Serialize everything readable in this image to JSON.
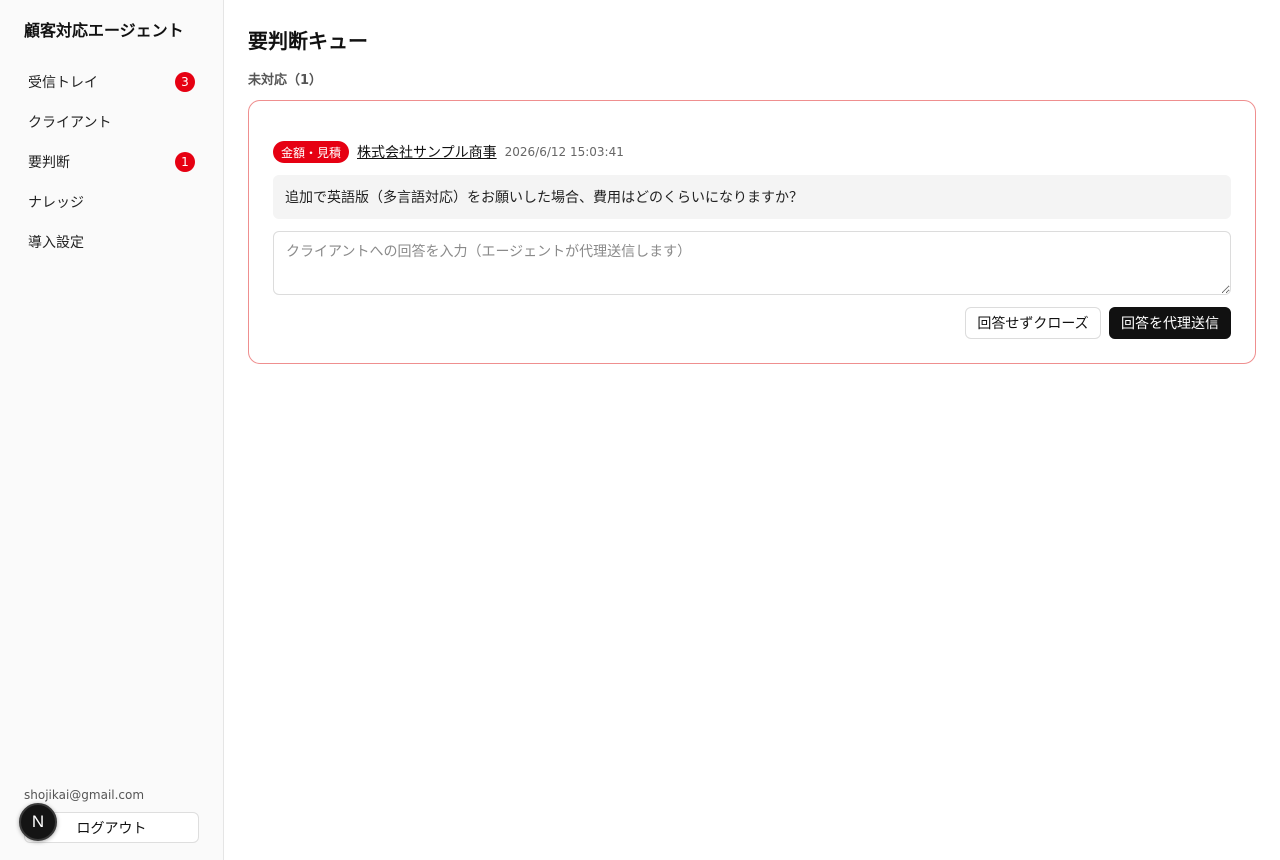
{
  "app": {
    "title": "顧客対応エージェント"
  },
  "sidebar": {
    "items": [
      {
        "label": "受信トレイ",
        "badge": "3"
      },
      {
        "label": "クライアント"
      },
      {
        "label": "要判断",
        "badge": "1"
      },
      {
        "label": "ナレッジ"
      },
      {
        "label": "導入設定"
      }
    ],
    "user_email": "shojikai@gmail.com",
    "logout_label": "ログアウト",
    "avatar_letter": "N"
  },
  "main": {
    "title": "要判断キュー",
    "section_title": "未対応（1）",
    "cards": [
      {
        "category": "金額・見積",
        "client": "株式会社サンプル商事",
        "timestamp": "2026/6/12 15:03:41",
        "message": "追加で英語版（多言語対応）をお願いした場合、費用はどのくらいになりますか？",
        "reply_placeholder": "クライアントへの回答を入力（エージェントが代理送信します）",
        "close_label": "回答せずクローズ",
        "send_label": "回答を代理送信"
      }
    ]
  },
  "colors": {
    "accent_red": "#e60012",
    "card_border": "#ef8f8f",
    "primary_button": "#111111"
  }
}
